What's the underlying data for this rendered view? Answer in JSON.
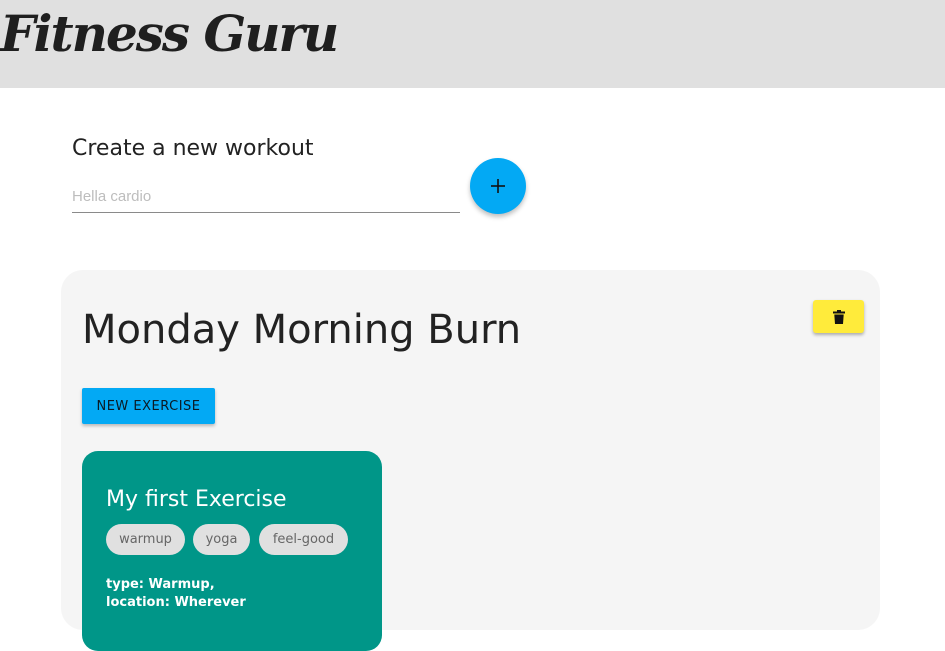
{
  "header": {
    "app_title": "Fitness Guru"
  },
  "create_workout": {
    "label": "Create a new workout",
    "input_value": "",
    "input_placeholder": "Hella cardio",
    "add_icon": "plus-icon"
  },
  "workout": {
    "title": "Monday Morning Burn",
    "delete_icon": "trash-icon",
    "new_exercise_label": "NEW EXERCISE",
    "exercise": {
      "title": "My first Exercise",
      "tags": [
        "warmup",
        "yoga",
        "feel-good"
      ],
      "type_line": "type: Warmup,",
      "location_line": "location: Wherever"
    }
  },
  "colors": {
    "header_bg": "#e0e0e0",
    "primary": "#03a9f4",
    "delete": "#ffeb3b",
    "exercise_card": "#009688",
    "workout_card": "#f5f5f5",
    "chip": "#e0e0e0"
  }
}
